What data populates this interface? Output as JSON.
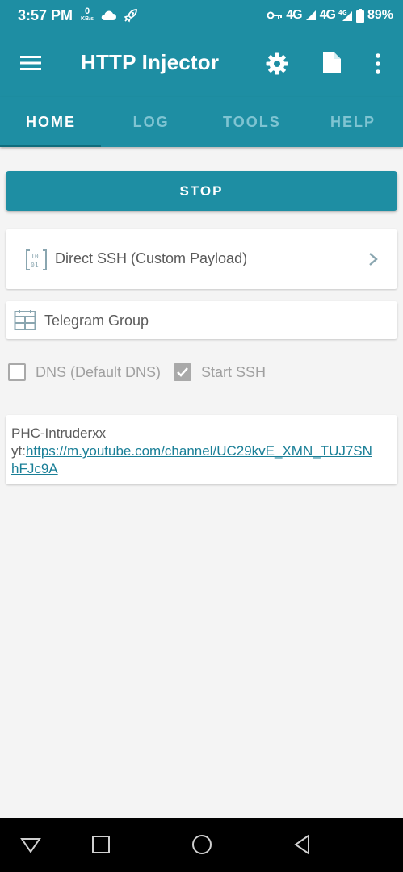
{
  "status_bar": {
    "time": "3:57 PM",
    "speed_value": "0",
    "speed_unit": "KB/s",
    "net1": "4G",
    "net2": "4G",
    "battery": "89%"
  },
  "app_bar": {
    "title": "HTTP Injector",
    "icons": [
      "menu-icon",
      "gear-icon",
      "document-icon",
      "more-vert-icon"
    ]
  },
  "tabs": [
    {
      "label": "HOME",
      "active": true
    },
    {
      "label": "LOG",
      "active": false
    },
    {
      "label": "TOOLS",
      "active": false
    },
    {
      "label": "HELP",
      "active": false
    }
  ],
  "main": {
    "stop_label": "STOP",
    "mode_label": "Direct SSH (Custom Payload)",
    "telegram_label": "Telegram Group",
    "checkboxes": [
      {
        "label": "DNS (Default DNS)",
        "checked": false
      },
      {
        "label": "Start SSH",
        "checked": true
      }
    ],
    "info": {
      "line1": "PHC-Intruderxx",
      "prefix": "yt:",
      "link": "https://m.youtube.com/channel/UC29kvE_XMN_TUJ7SNhFJc9A"
    }
  },
  "nav_bar": {
    "icons": [
      "down-triangle-icon",
      "square-icon",
      "circle-icon",
      "back-triangle-icon"
    ]
  },
  "colors": {
    "primary": "#1e8ea3",
    "background": "#f4f4f4",
    "link": "#1a7f97"
  }
}
